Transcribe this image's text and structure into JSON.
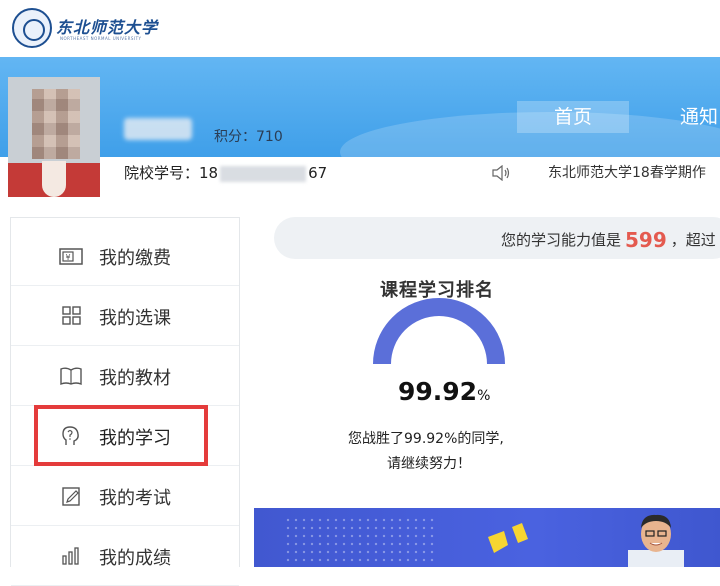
{
  "header": {
    "school_name": "东北师范大学",
    "school_name_en": "NORTHEAST NORMAL UNIVERSITY"
  },
  "profile": {
    "points_label": "积分：710",
    "student_no_prefix": "院校学号：18",
    "student_no_suffix": "67"
  },
  "nav": {
    "home": "首页",
    "notice": "通知"
  },
  "ticker": {
    "text": "东北师范大学18春学期作"
  },
  "sidebar": {
    "items": [
      {
        "label": "我的缴费",
        "icon": "payment-icon"
      },
      {
        "label": "我的选课",
        "icon": "grid-icon"
      },
      {
        "label": "我的教材",
        "icon": "book-icon"
      },
      {
        "label": "我的学习",
        "icon": "head-question-icon"
      },
      {
        "label": "我的考试",
        "icon": "exam-edit-icon"
      },
      {
        "label": "我的成绩",
        "icon": "bar-chart-icon"
      }
    ],
    "active_index": 3
  },
  "ability": {
    "prefix": "您的学习能力值是",
    "score": "599",
    "suffix": "，超过"
  },
  "ranking": {
    "title": "课程学习排名",
    "percent_value": "99.92",
    "percent_unit": "%",
    "beat_text": "您战胜了99.92%的同学,",
    "encourage_text": "请继续努力！"
  },
  "colors": {
    "banner": "#4aa6ee",
    "gauge": "#5b6fd9",
    "highlight": "#e43b3b",
    "score": "#e45a4f",
    "promo": "#4158d0"
  }
}
